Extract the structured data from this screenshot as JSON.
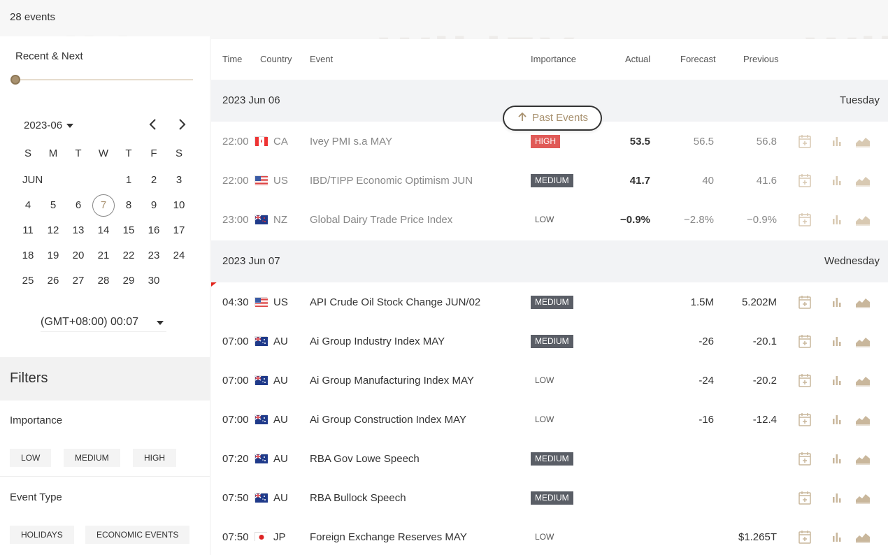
{
  "header": {
    "count": "28 events"
  },
  "sidebar": {
    "recent_label": "Recent & Next",
    "month": "2023-06",
    "weekdays": [
      "S",
      "M",
      "T",
      "W",
      "T",
      "F",
      "S"
    ],
    "month_label": "JUN",
    "weeks": [
      [
        "",
        "",
        "",
        "",
        "1",
        "2",
        "3"
      ],
      [
        "4",
        "5",
        "6",
        "7",
        "8",
        "9",
        "10"
      ],
      [
        "11",
        "12",
        "13",
        "14",
        "15",
        "16",
        "17"
      ],
      [
        "18",
        "19",
        "20",
        "21",
        "22",
        "23",
        "24"
      ],
      [
        "25",
        "26",
        "27",
        "28",
        "29",
        "30",
        ""
      ]
    ],
    "today": "7",
    "timezone": "(GMT+08:00) 00:07",
    "filters_title": "Filters",
    "importance_title": "Importance",
    "importance_options": [
      "LOW",
      "MEDIUM",
      "HIGH"
    ],
    "event_type_title": "Event Type",
    "event_type_options": [
      "HOLIDAYS",
      "ECONOMIC EVENTS"
    ]
  },
  "table": {
    "headers": {
      "time": "Time",
      "country": "Country",
      "event": "Event",
      "importance": "Importance",
      "actual": "Actual",
      "forecast": "Forecast",
      "previous": "Previous"
    },
    "past_events_label": "Past Events",
    "groups": [
      {
        "date": "2023 Jun 06",
        "weekday": "Tuesday",
        "events": [
          {
            "time": "22:00",
            "country": "CA",
            "event": "Ivey PMI s.a MAY",
            "importance": "HIGH",
            "actual": "53.5",
            "forecast": "56.5",
            "previous": "56.8",
            "past": true
          },
          {
            "time": "22:00",
            "country": "US",
            "event": "IBD/TIPP Economic Optimism JUN",
            "importance": "MEDIUM",
            "actual": "41.7",
            "forecast": "40",
            "previous": "41.6",
            "past": true
          },
          {
            "time": "23:00",
            "country": "NZ",
            "event": "Global Dairy Trade Price Index",
            "importance": "LOW",
            "actual": "−0.9%",
            "forecast": "−2.8%",
            "previous": "−0.9%",
            "past": true
          }
        ]
      },
      {
        "date": "2023 Jun 07",
        "weekday": "Wednesday",
        "events": [
          {
            "time": "04:30",
            "country": "US",
            "event": "API Crude Oil Stock Change JUN/02",
            "importance": "MEDIUM",
            "actual": "",
            "forecast": "1.5M",
            "previous": "5.202M",
            "past": false
          },
          {
            "time": "07:00",
            "country": "AU",
            "event": "Ai Group Industry Index MAY",
            "importance": "MEDIUM",
            "actual": "",
            "forecast": "-26",
            "previous": "-20.1",
            "past": false
          },
          {
            "time": "07:00",
            "country": "AU",
            "event": "Ai Group Manufacturing Index MAY",
            "importance": "LOW",
            "actual": "",
            "forecast": "-24",
            "previous": "-20.2",
            "past": false
          },
          {
            "time": "07:00",
            "country": "AU",
            "event": "Ai Group Construction Index MAY",
            "importance": "LOW",
            "actual": "",
            "forecast": "-16",
            "previous": "-12.4",
            "past": false
          },
          {
            "time": "07:20",
            "country": "AU",
            "event": "RBA Gov Lowe Speech",
            "importance": "MEDIUM",
            "actual": "",
            "forecast": "",
            "previous": "",
            "past": false
          },
          {
            "time": "07:50",
            "country": "AU",
            "event": "RBA Bullock Speech",
            "importance": "MEDIUM",
            "actual": "",
            "forecast": "",
            "previous": "",
            "past": false
          },
          {
            "time": "07:50",
            "country": "JP",
            "event": "Foreign Exchange Reserves MAY",
            "importance": "LOW",
            "actual": "",
            "forecast": "",
            "previous": "$1.265T",
            "past": false
          }
        ]
      }
    ]
  },
  "colors": {
    "accent": "#a8916f",
    "high": "#e05a57",
    "medium": "#5a5e66",
    "timeline": "#e2231a"
  },
  "icons": [
    "chevron-left-icon",
    "chevron-right-icon",
    "calendar-add-icon",
    "bar-chart-icon",
    "area-chart-icon",
    "arrow-up-icon"
  ]
}
